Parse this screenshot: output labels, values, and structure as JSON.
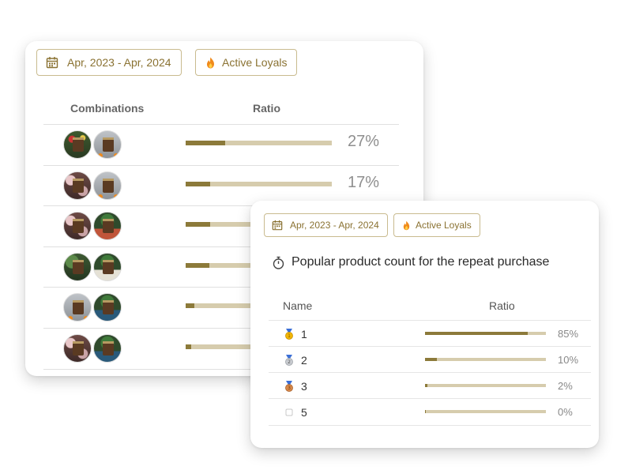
{
  "colors": {
    "accent": "#8a7232",
    "bar_fill": "#8c7a3a",
    "bar_track": "#d6ccad"
  },
  "back_card": {
    "date_range": "Apr, 2023 - Apr, 2024",
    "segment": "Active Loyals",
    "col_combinations": "Combinations",
    "col_ratio": "Ratio",
    "rows": [
      {
        "ratio": 0.27,
        "pct": "27%"
      },
      {
        "ratio": 0.17,
        "pct": "17%"
      },
      {
        "ratio": 0.17,
        "pct": ""
      },
      {
        "ratio": 0.16,
        "pct": ""
      },
      {
        "ratio": 0.06,
        "pct": ""
      },
      {
        "ratio": 0.04,
        "pct": ""
      }
    ]
  },
  "front_card": {
    "date_range": "Apr, 2023 - Apr, 2024",
    "segment": "Active Loyals",
    "title": "Popular product count for the repeat purchase",
    "col_name": "Name",
    "col_ratio": "Ratio",
    "rows": [
      {
        "medal": "gold-medal-icon",
        "name": "1",
        "ratio": 0.85,
        "pct": "85%"
      },
      {
        "medal": "silver-medal-icon",
        "name": "2",
        "ratio": 0.1,
        "pct": "10%"
      },
      {
        "medal": "bronze-medal-icon",
        "name": "3",
        "ratio": 0.02,
        "pct": "2%"
      },
      {
        "medal": "empty-box-icon",
        "name": "5",
        "ratio": 0.0,
        "pct": "0%"
      }
    ]
  }
}
